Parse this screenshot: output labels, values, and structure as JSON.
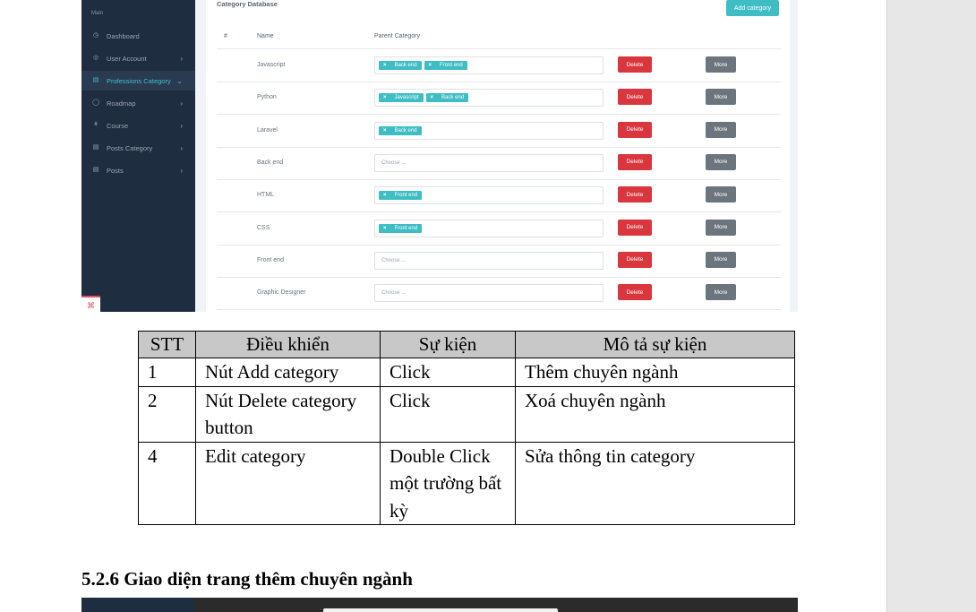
{
  "app": {
    "sidebar": {
      "section": "Main",
      "items": [
        {
          "label": "Dashboard",
          "icon": "dashboard-icon",
          "glyph": "◷",
          "chevron": false,
          "active": false
        },
        {
          "label": "User Account",
          "icon": "user-icon",
          "glyph": "◎",
          "chevron": true,
          "active": false
        },
        {
          "label": "Professions Category",
          "icon": "category-icon",
          "glyph": "▤",
          "chevron": true,
          "active": true
        },
        {
          "label": "Roadmap",
          "icon": "roadmap-icon",
          "glyph": "◯",
          "chevron": true,
          "active": false
        },
        {
          "label": "Course",
          "icon": "course-icon",
          "glyph": "⚘",
          "chevron": true,
          "active": false
        },
        {
          "label": "Posts Category",
          "icon": "posts-category-icon",
          "glyph": "▤",
          "chevron": true,
          "active": false
        },
        {
          "label": "Posts",
          "icon": "posts-icon",
          "glyph": "▤",
          "chevron": true,
          "active": false
        }
      ]
    },
    "panel": {
      "title": "Category Database",
      "add_button": "Add category",
      "columns": [
        "#",
        "Name",
        "Parent Category"
      ],
      "placeholder": "Choose ...",
      "delete_label": "Delete",
      "more_label": "More",
      "rows": [
        {
          "name": "Javascript",
          "tags": [
            "Back end",
            "Front end"
          ]
        },
        {
          "name": "Python",
          "tags": [
            "Javascript",
            "Back end"
          ]
        },
        {
          "name": "Laravel",
          "tags": [
            "Back end"
          ]
        },
        {
          "name": "Back end",
          "tags": []
        },
        {
          "name": "HTML",
          "tags": [
            "Front end"
          ]
        },
        {
          "name": "CSS",
          "tags": [
            "Front end"
          ]
        },
        {
          "name": "Front end",
          "tags": []
        },
        {
          "name": "Graphic Designer",
          "tags": []
        }
      ]
    },
    "colors": {
      "accent": "#3ebdc5",
      "danger": "#d9363e",
      "secondary": "#6c757d",
      "sidebar": "#1f2d40"
    }
  },
  "doc_table": {
    "headers": [
      "STT",
      "Điều khiển",
      "Sự kiện",
      "Mô tả sự kiện"
    ],
    "rows": [
      {
        "stt": "1",
        "control": "Nút Add category",
        "event": "Click",
        "desc": "Thêm chuyên ngành"
      },
      {
        "stt": "2",
        "control": "Nút Delete category button",
        "event": "Click",
        "desc": "Xoá chuyên ngành"
      },
      {
        "stt": "4",
        "control": "Edit category",
        "event": "Double Click một trường bất kỳ",
        "desc": "Sửa thông tin category"
      }
    ]
  },
  "section_heading": "5.2.6 Giao diện trang thêm chuyên ngành"
}
